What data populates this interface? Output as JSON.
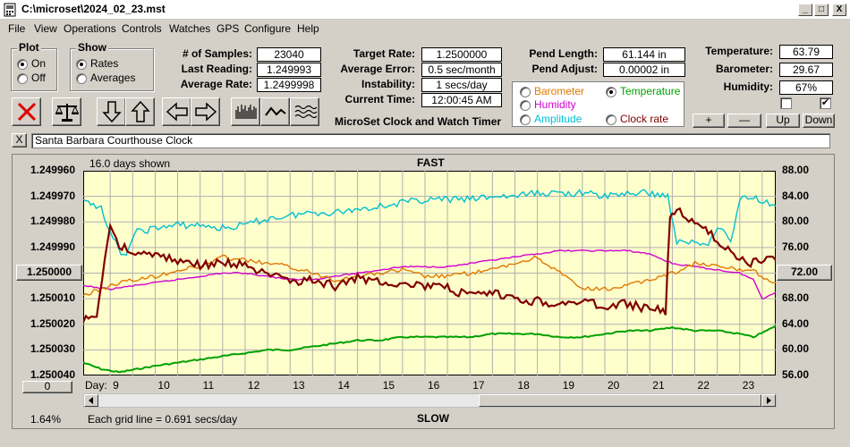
{
  "window": {
    "title": "C:\\microset\\2024_02_23.mst",
    "controls": [
      "_",
      "□",
      "X"
    ]
  },
  "menu": [
    "File",
    "View",
    "Operations",
    "Controls",
    "Watches",
    "GPS",
    "Configure",
    "Help"
  ],
  "plot_group": {
    "title": "Plot",
    "options": [
      "On",
      "Off"
    ],
    "selected": "On"
  },
  "show_group": {
    "title": "Show",
    "options": [
      "Rates",
      "Averages"
    ],
    "selected": "Rates"
  },
  "stats": {
    "samples_label": "# of Samples:",
    "samples": "23040",
    "last_label": "Last Reading:",
    "last": "1.249993",
    "avg_label": "Average Rate:",
    "avg": "1.2499998"
  },
  "rates": {
    "target_label": "Target Rate:",
    "target": "1.2500000",
    "error_label": "Average Error:",
    "error": "0.5 sec/month",
    "instab_label": "Instability:",
    "instab": "1 secs/day",
    "time_label": "Current Time:",
    "time": "12:00:45 AM",
    "caption": "MicroSet Clock and Watch Timer"
  },
  "pend": {
    "length_label": "Pend Length:",
    "length": "61.144 in",
    "adjust_label": "Pend Adjust:",
    "adjust": "0.00002 in"
  },
  "env": {
    "temp_label": "Temperature:",
    "temp": "63.79",
    "baro_label": "Barometer:",
    "baro": "29.67",
    "hum_label": "Humidity:",
    "hum": "67%"
  },
  "sensor_select": {
    "options": [
      "Barometer",
      "Temperature",
      "Humidity",
      "Clock rate",
      "Amplitude"
    ],
    "selected": "Temperature",
    "colors": {
      "Barometer": "#e07800",
      "Temperature": "#00a000",
      "Humidity": "#d000d0",
      "Clock rate": "#800000",
      "Amplitude": "#00c0d0"
    }
  },
  "scale_buttons": [
    "+",
    "—",
    "Up",
    "Down"
  ],
  "checkboxes": [
    false,
    true
  ],
  "clock_name": "Santa Barbara Courthouse Clock",
  "close_x": "X",
  "graph": {
    "days_shown": "16.0 days shown",
    "fast": "FAST",
    "slow": "SLOW",
    "grid_note": "Each grid line = 0.691 secs/day",
    "percent": "1.64%",
    "center_button": "1.250000",
    "right_button": "72.00",
    "zero_button": "0",
    "day_label": "Day:"
  },
  "chart_data": {
    "type": "line",
    "xlabel": "Day:",
    "x_ticks": [
      "9",
      "10",
      "11",
      "12",
      "13",
      "14",
      "15",
      "16",
      "17",
      "18",
      "19",
      "20",
      "21",
      "22",
      "23"
    ],
    "x_range": [
      8.4,
      23.8
    ],
    "left_axis": {
      "ticks": [
        "1.249960",
        "1.249970",
        "1.249980",
        "1.249990",
        "1.250000",
        "1.250010",
        "1.250020",
        "1.250030",
        "1.250040"
      ],
      "range": [
        1.25004,
        1.24996
      ],
      "note": "inverted: faster rates (smaller period) at top"
    },
    "right_axis": {
      "ticks": [
        "88.00",
        "84.00",
        "80.00",
        "76.00",
        "72.00",
        "68.00",
        "64.00",
        "60.00",
        "56.00"
      ],
      "range": [
        56,
        88
      ]
    },
    "grid": true,
    "background": "#ffffcc",
    "series": [
      {
        "name": "Clock rate",
        "color": "#800000",
        "axis": "left",
        "x": [
          8.4,
          8.7,
          9.0,
          9.2,
          9.5,
          10.0,
          10.5,
          11.0,
          11.5,
          12.0,
          12.5,
          13.0,
          13.5,
          14.0,
          14.5,
          15.0,
          15.5,
          16.0,
          16.5,
          17.0,
          17.5,
          18.0,
          18.5,
          19.0,
          19.5,
          20.0,
          20.5,
          21.0,
          21.35,
          21.45,
          21.6,
          21.8,
          22.0,
          22.3,
          22.5,
          22.8,
          23.0,
          23.3,
          23.6,
          23.8
        ],
        "values": [
          1.250019,
          1.250016,
          1.249981,
          1.249989,
          1.249992,
          1.249993,
          1.249995,
          1.249997,
          1.249996,
          1.249997,
          1.250001,
          1.250003,
          1.250003,
          1.250005,
          1.250002,
          1.250003,
          1.250004,
          1.250005,
          1.250006,
          1.250009,
          1.250008,
          1.25001,
          1.250011,
          1.250012,
          1.250011,
          1.250013,
          1.250012,
          1.250014,
          1.250015,
          1.249978,
          1.249974,
          1.249978,
          1.249981,
          1.249984,
          1.249987,
          1.249991,
          1.249995,
          1.249996,
          1.249994,
          1.249995
        ]
      },
      {
        "name": "Amplitude",
        "color": "#00c0d0",
        "axis": "right",
        "x": [
          8.4,
          8.8,
          9.0,
          9.3,
          9.6,
          10.0,
          10.5,
          11.0,
          11.5,
          12.0,
          12.5,
          13.0,
          13.5,
          14.0,
          14.5,
          15.0,
          15.5,
          16.0,
          16.5,
          17.0,
          17.5,
          18.0,
          18.5,
          19.0,
          19.5,
          20.0,
          20.5,
          21.0,
          21.4,
          21.6,
          21.8,
          22.0,
          22.3,
          22.5,
          22.8,
          23.0,
          23.3,
          23.6,
          23.8
        ],
        "values": [
          83.0,
          82.5,
          78.0,
          74.5,
          78.5,
          79.0,
          79.5,
          79.5,
          79.0,
          79.5,
          80.5,
          81.0,
          81.5,
          81.5,
          82.0,
          82.5,
          83.0,
          83.5,
          83.5,
          83.5,
          84.0,
          84.0,
          84.5,
          84.5,
          84.5,
          84.0,
          84.5,
          84.5,
          84.0,
          77.0,
          76.5,
          77.0,
          76.5,
          79.5,
          77.0,
          83.5,
          84.0,
          83.0,
          82.5
        ]
      },
      {
        "name": "Barometer",
        "color": "#e07800",
        "axis": "right",
        "x": [
          8.4,
          8.8,
          9.2,
          9.6,
          10.0,
          10.5,
          11.0,
          11.5,
          12.0,
          12.5,
          13.0,
          13.5,
          14.0,
          14.5,
          15.0,
          15.5,
          16.0,
          16.5,
          17.0,
          17.5,
          18.0,
          18.5,
          19.0,
          19.5,
          20.0,
          20.5,
          21.0,
          21.5,
          22.0,
          22.5,
          23.0,
          23.3,
          23.6,
          23.8
        ],
        "values": [
          68.5,
          69.5,
          70.5,
          71.0,
          71.5,
          72.5,
          73.0,
          74.5,
          74.0,
          73.5,
          73.0,
          72.0,
          71.0,
          71.5,
          72.0,
          72.5,
          71.5,
          71.5,
          72.0,
          72.5,
          73.5,
          74.5,
          72.0,
          69.5,
          69.5,
          70.0,
          71.0,
          72.0,
          73.5,
          73.0,
          72.5,
          72.5,
          71.0,
          70.5
        ]
      },
      {
        "name": "Humidity",
        "color": "#d000d0",
        "axis": "right",
        "x": [
          8.4,
          9.0,
          9.5,
          10.0,
          10.5,
          11.0,
          11.5,
          12.0,
          12.5,
          13.0,
          13.5,
          14.0,
          14.5,
          15.0,
          15.5,
          16.0,
          16.5,
          17.0,
          17.5,
          18.0,
          18.5,
          19.0,
          19.5,
          20.0,
          20.5,
          21.0,
          21.5,
          22.0,
          22.5,
          23.0,
          23.3,
          23.5,
          23.8
        ],
        "values": [
          70.0,
          69.5,
          70.0,
          70.5,
          71.0,
          71.5,
          72.0,
          72.0,
          71.5,
          71.0,
          71.0,
          71.5,
          72.0,
          72.5,
          73.0,
          73.0,
          73.0,
          73.5,
          74.0,
          74.5,
          75.0,
          75.5,
          75.5,
          75.5,
          75.5,
          75.0,
          73.5,
          73.0,
          72.5,
          72.0,
          71.0,
          68.0,
          69.0
        ]
      },
      {
        "name": "Temperature",
        "color": "#00a000",
        "axis": "right",
        "x": [
          8.4,
          8.8,
          9.2,
          9.6,
          10.0,
          10.5,
          11.0,
          11.5,
          12.0,
          12.5,
          13.0,
          13.5,
          14.0,
          14.5,
          15.0,
          15.5,
          16.0,
          16.5,
          17.0,
          17.5,
          18.0,
          18.5,
          19.0,
          19.5,
          20.0,
          20.5,
          21.0,
          21.5,
          22.0,
          22.5,
          23.0,
          23.3,
          23.6,
          23.8
        ],
        "values": [
          58.0,
          57.0,
          56.5,
          57.0,
          57.5,
          58.0,
          58.5,
          59.0,
          59.5,
          60.0,
          60.0,
          60.5,
          61.0,
          61.5,
          61.5,
          62.0,
          62.0,
          62.0,
          62.0,
          62.5,
          62.5,
          62.5,
          62.0,
          62.0,
          62.5,
          63.0,
          63.0,
          63.5,
          63.0,
          63.0,
          62.5,
          62.0,
          63.0,
          63.8
        ]
      }
    ]
  }
}
